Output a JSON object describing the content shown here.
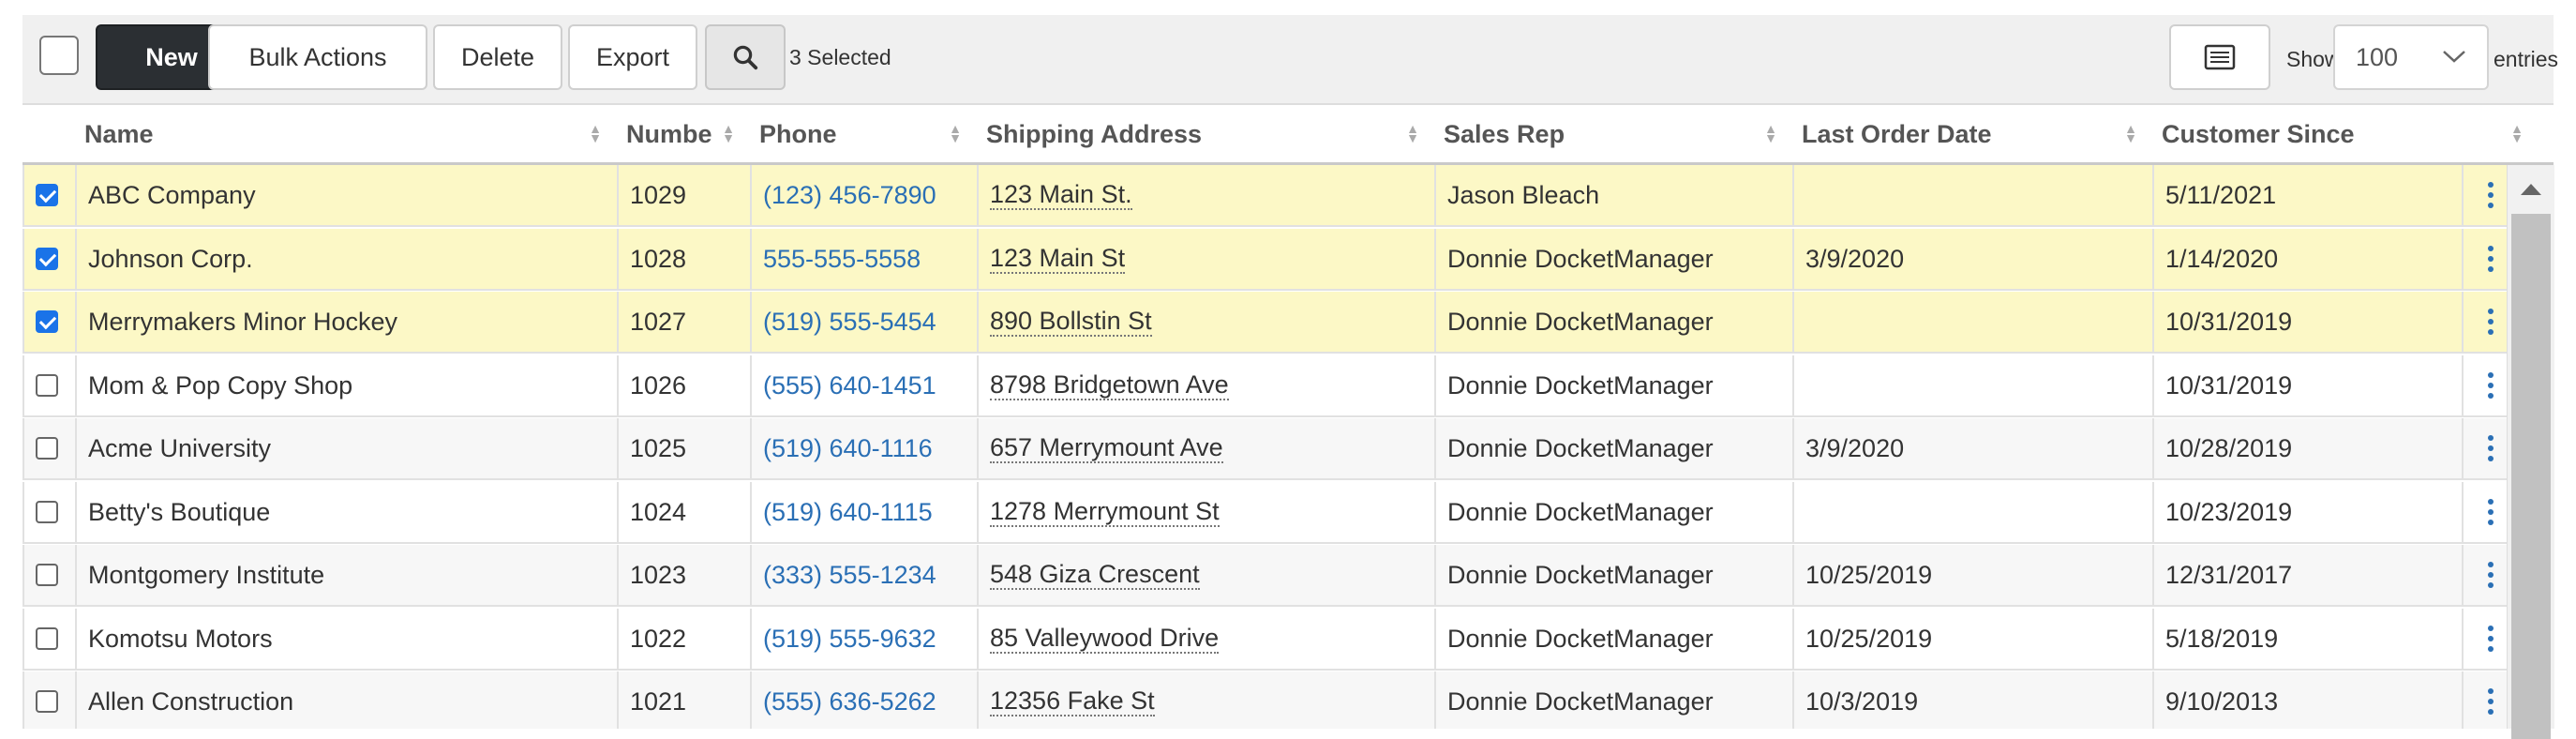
{
  "toolbar": {
    "new_label": "New",
    "bulk_label": "Bulk Actions",
    "delete_label": "Delete",
    "export_label": "Export",
    "selected_text": "3 Selected",
    "show_label": "Show",
    "entries_value": "100",
    "entries_label": "entries"
  },
  "columns": {
    "name": "Name",
    "number": "Numbe",
    "phone": "Phone",
    "shipping": "Shipping Address",
    "sales_rep": "Sales Rep",
    "last_order": "Last Order Date",
    "customer_since": "Customer Since"
  },
  "rows": [
    {
      "checked": true,
      "name": "ABC Company",
      "number": "1029",
      "phone": "(123) 456-7890",
      "address": "123 Main St.",
      "rep": "Jason Bleach",
      "last": "",
      "since": "5/11/2021"
    },
    {
      "checked": true,
      "name": "Johnson Corp.",
      "number": "1028",
      "phone": "555-555-5558",
      "address": "123 Main St",
      "rep": "Donnie DocketManager",
      "last": "3/9/2020",
      "since": "1/14/2020"
    },
    {
      "checked": true,
      "name": "Merrymakers Minor Hockey",
      "number": "1027",
      "phone": "(519) 555-5454",
      "address": "890 Bollstin St",
      "rep": "Donnie DocketManager",
      "last": "",
      "since": "10/31/2019"
    },
    {
      "checked": false,
      "name": "Mom & Pop Copy Shop",
      "number": "1026",
      "phone": "(555) 640-1451",
      "address": "8798 Bridgetown Ave",
      "rep": "Donnie DocketManager",
      "last": "",
      "since": "10/31/2019"
    },
    {
      "checked": false,
      "name": "Acme University",
      "number": "1025",
      "phone": "(519) 640-1116",
      "address": "657 Merrymount Ave",
      "rep": "Donnie DocketManager",
      "last": "3/9/2020",
      "since": "10/28/2019"
    },
    {
      "checked": false,
      "name": "Betty's Boutique",
      "number": "1024",
      "phone": "(519) 640-1115",
      "address": "1278 Merrymount St",
      "rep": "Donnie DocketManager",
      "last": "",
      "since": "10/23/2019"
    },
    {
      "checked": false,
      "name": "Montgomery Institute",
      "number": "1023",
      "phone": "(333) 555-1234",
      "address": "548 Giza Crescent",
      "rep": "Donnie DocketManager",
      "last": "10/25/2019",
      "since": "12/31/2017"
    },
    {
      "checked": false,
      "name": "Komotsu Motors",
      "number": "1022",
      "phone": "(519) 555-9632",
      "address": "85 Valleywood Drive",
      "rep": "Donnie DocketManager",
      "last": "10/25/2019",
      "since": "5/18/2019"
    },
    {
      "checked": false,
      "name": "Allen Construction",
      "number": "1021",
      "phone": "(555) 636-5262",
      "address": "12356 Fake St",
      "rep": "Donnie DocketManager",
      "last": "10/3/2019",
      "since": "9/10/2013"
    }
  ],
  "icons": {
    "search": "search-icon",
    "columns": "list-columns-icon",
    "row_menu": "kebab-menu-icon"
  },
  "colors": {
    "selected_row": "#fcf8c6",
    "link": "#2a6fb5",
    "new_button": "#2b2f33"
  }
}
